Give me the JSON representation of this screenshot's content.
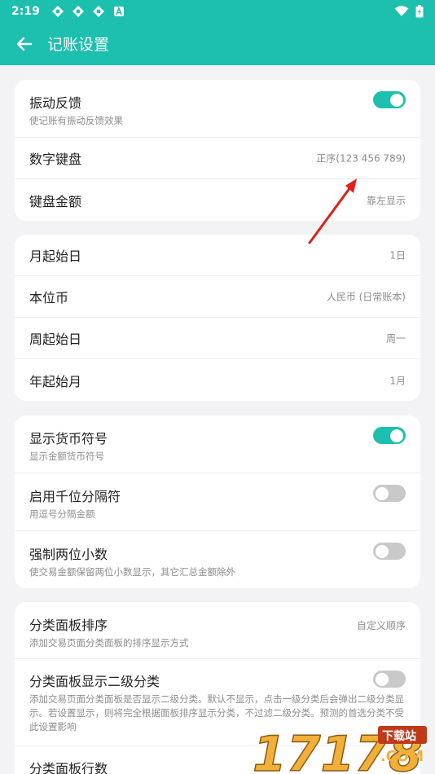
{
  "status": {
    "time": "2:19"
  },
  "appbar": {
    "title": "记账设置"
  },
  "card1": [
    {
      "label": "振动反馈",
      "sub": "使记账有振动反馈效果",
      "toggle": true
    },
    {
      "label": "数字键盘",
      "value": "正序(123 456 789)"
    },
    {
      "label": "键盘金额",
      "value": "靠左显示"
    }
  ],
  "card2": [
    {
      "label": "月起始日",
      "value": "1日"
    },
    {
      "label": "本位币",
      "value": "人民币 (日常账本)"
    },
    {
      "label": "周起始日",
      "value": "周一"
    },
    {
      "label": "年起始月",
      "value": "1月"
    }
  ],
  "card3": [
    {
      "label": "显示货币符号",
      "sub": "显示金额货币符号",
      "toggle": true
    },
    {
      "label": "启用千位分隔符",
      "sub": "用逗号分隔金额",
      "toggle": false
    },
    {
      "label": "强制两位小数",
      "sub": "使交易金额保留两位小数显示，其它汇总金额除外",
      "toggle": false
    }
  ],
  "card4": [
    {
      "label": "分类面板排序",
      "sub": "添加交易页面分类面板的排序显示方式",
      "value": "自定义顺序"
    },
    {
      "label": "分类面板显示二级分类",
      "sub": "添加交易页面分类面板是否显示二级分类。默认不显示，点击一级分类后会弹出二级分类显示。若设置显示，则将完全根据面板排序显示分类，不过滤二级分类。预测的首选分类不受此设置影响",
      "toggle": false
    },
    {
      "label": "分类面板行数"
    }
  ],
  "watermark": {
    "text": "17178",
    "badge": "下载站",
    "domain": ".COM"
  },
  "colors": {
    "accent": "#1dbfae",
    "toggle_off": "#c9c9c9",
    "annotation_arrow": "#e0201b"
  }
}
